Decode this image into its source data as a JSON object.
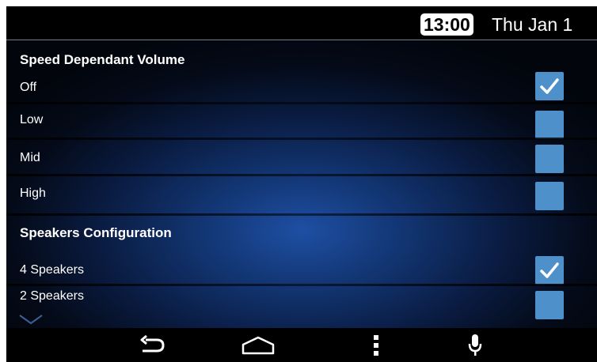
{
  "status_bar": {
    "time": "13:00",
    "date": "Thu Jan 1"
  },
  "sections": [
    {
      "title": "Speed Dependant Volume",
      "options": [
        {
          "label": "Off",
          "checked": true
        },
        {
          "label": "Low",
          "checked": false
        },
        {
          "label": "Mid",
          "checked": false
        },
        {
          "label": "High",
          "checked": false
        }
      ]
    },
    {
      "title": "Speakers Configuration",
      "options": [
        {
          "label": "4 Speakers",
          "checked": true
        },
        {
          "label": "2 Speakers",
          "checked": false
        }
      ]
    }
  ],
  "nav_bar": {
    "buttons": [
      "back-icon",
      "home-icon",
      "menu-icon",
      "microphone-icon"
    ]
  },
  "colors": {
    "checkbox": "#4e90ca",
    "background_center": "#1e4fa3",
    "bar": "#000000"
  }
}
